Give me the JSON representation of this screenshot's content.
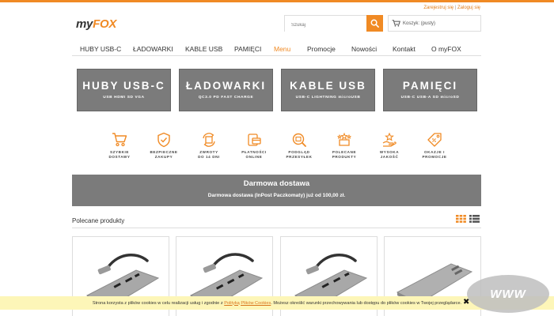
{
  "colors": {
    "accent": "#f08a24",
    "tile": "#7b7b7b",
    "cookie_bg": "#fdf6b8"
  },
  "header": {
    "register": "Zarejestruj się",
    "separator": "|",
    "login": "Zaloguj się",
    "logo_prefix": "my",
    "logo_brand": "FOX",
    "search_placeholder": "Szukaj",
    "cart_label": "Koszyk: (pusty)"
  },
  "nav": [
    {
      "label": "HUBY USB-C"
    },
    {
      "label": "ŁADOWARKI"
    },
    {
      "label": "KABLE USB"
    },
    {
      "label": "PAMIĘCI"
    },
    {
      "label": "Menu"
    },
    {
      "label": "Promocje"
    },
    {
      "label": "Nowości"
    },
    {
      "label": "Kontakt"
    },
    {
      "label": "O myFOX"
    }
  ],
  "categories": [
    {
      "title": "HUBY USB-C",
      "subtitle": "USB HDMI SD VGA"
    },
    {
      "title": "ŁADOWARKI",
      "subtitle": "QC3.0 PD FAST CHARGE"
    },
    {
      "title": "KABLE USB",
      "subtitle": "USB-C LIGHTNING microUSB"
    },
    {
      "title": "PAMIĘCI",
      "subtitle": "USB-C USB-A SD microSD"
    }
  ],
  "features": [
    {
      "label": "SZYBKIE\nDOSTAWY",
      "icon": "cart-icon"
    },
    {
      "label": "BEZPIECZNE\nZAKUPY",
      "icon": "shield-check-icon"
    },
    {
      "label": "ZWROTY\nDO 14 DNI",
      "icon": "return-box-icon"
    },
    {
      "label": "PŁATNOŚCI\nONLINE",
      "icon": "card-payment-icon"
    },
    {
      "label": "PODGLĄD\nPRZESYŁEK",
      "icon": "tracking-search-icon"
    },
    {
      "label": "POLECANE\nPRODUKTY",
      "icon": "stars-box-icon"
    },
    {
      "label": "WYSOKA\nJAKOŚĆ",
      "icon": "quality-hand-icon"
    },
    {
      "label": "OKAZJE I\nPROMOCJE",
      "icon": "discount-tag-icon"
    }
  ],
  "banner": {
    "title": "Darmowa dostawa",
    "text": "Darmowa dostawa (InPost Paczkomaty) już od 100,00 zł."
  },
  "products_section": {
    "title": "Polecane produkty"
  },
  "cookie": {
    "text_before": "Strona korzysta z plików cookies w celu realizacji usług i zgodnie z ",
    "link": "Polityką Plików Cookies",
    "text_after": ". Możesz określić warunki przechowywania lub dostępu do plików cookies w Twojej przeglądarce.",
    "close": "✖"
  },
  "badge": {
    "text": "WWW"
  }
}
